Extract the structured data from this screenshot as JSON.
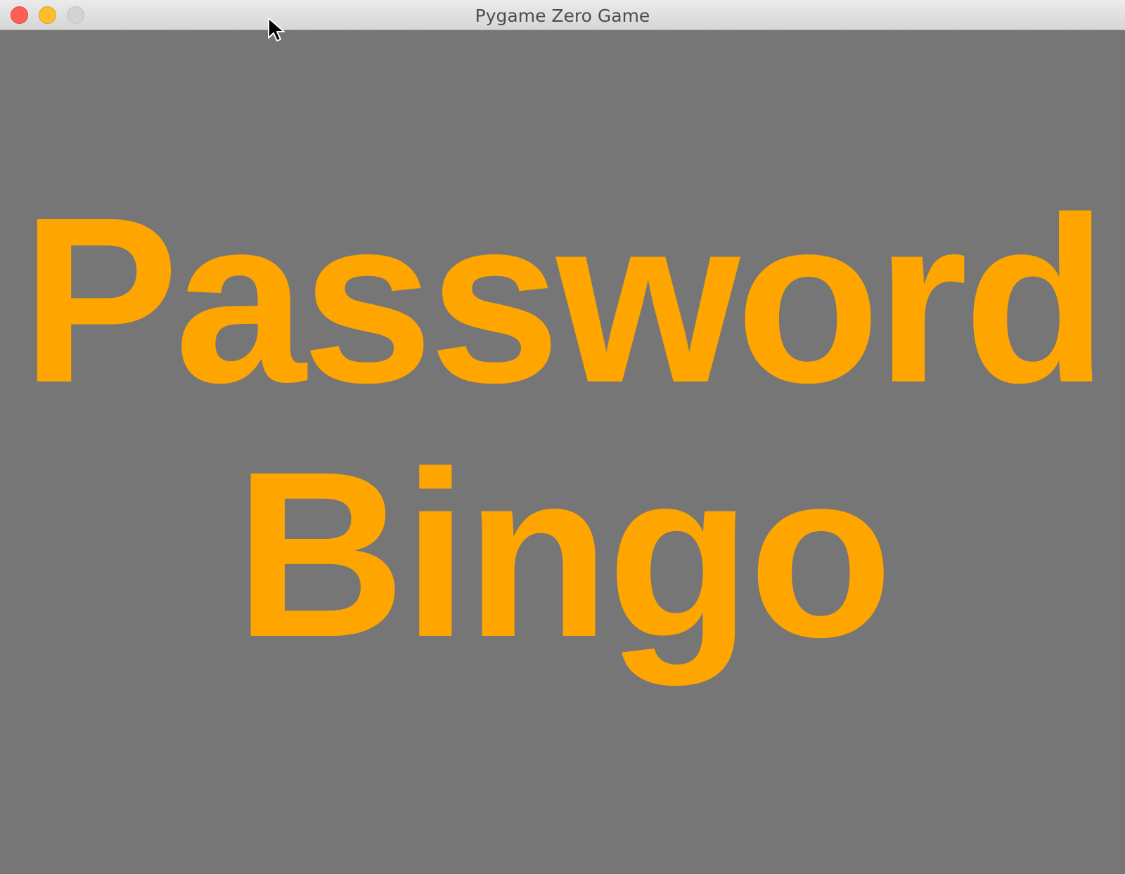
{
  "window": {
    "title": "Pygame Zero Game",
    "controls": [
      "close",
      "minimize",
      "zoom"
    ]
  },
  "game": {
    "background_color": "#767676",
    "text_color": "#ffa500",
    "title_lines": [
      "Password",
      "Bingo"
    ]
  },
  "cursor": {
    "icon": "arrow-pointer-icon"
  }
}
